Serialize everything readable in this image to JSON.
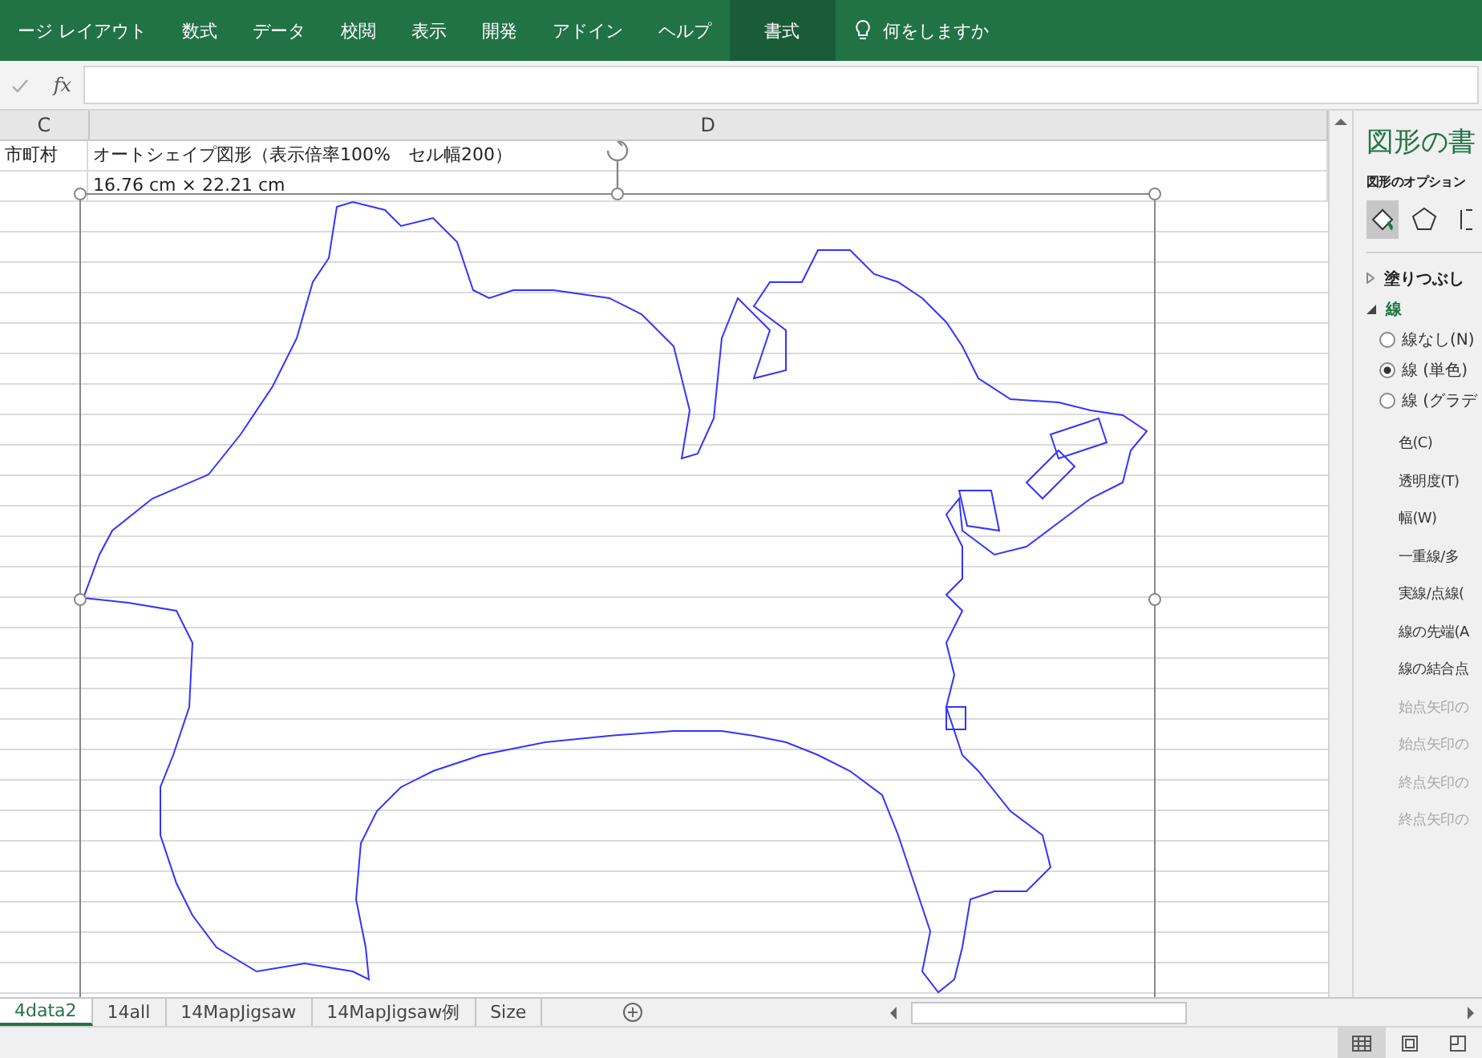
{
  "ribbon": {
    "tabs": [
      {
        "label": "ージ レイアウト",
        "selected": false
      },
      {
        "label": "数式",
        "selected": false
      },
      {
        "label": "データ",
        "selected": false
      },
      {
        "label": "校閲",
        "selected": false
      },
      {
        "label": "表示",
        "selected": false
      },
      {
        "label": "開発",
        "selected": false
      },
      {
        "label": "アドイン",
        "selected": false
      },
      {
        "label": "ヘルプ",
        "selected": false
      },
      {
        "label": "書式",
        "selected": true
      }
    ],
    "tell_me": "何をしますか"
  },
  "formula_bar": {
    "function_label": "fx"
  },
  "columns": [
    "C",
    "D"
  ],
  "rows": [
    {
      "c": "市町村",
      "d": "オートシェイプ図形（表示倍率100%　セル幅200）"
    },
    {
      "c": "",
      "d": "16.76 cm × 22.21 cm"
    }
  ],
  "pane": {
    "title": "図形の書",
    "subtitle": "図形のオプション",
    "sections": [
      {
        "label": "塗りつぶし",
        "expanded": false
      },
      {
        "label": "線",
        "expanded": true
      }
    ],
    "radios": [
      {
        "label": "線なし(N)",
        "selected": false
      },
      {
        "label": "線 (単色)",
        "selected": true
      },
      {
        "label": "線 (グラデ",
        "selected": false
      }
    ],
    "properties": [
      {
        "label": "色(C)",
        "disabled": false
      },
      {
        "label": "透明度(T)",
        "disabled": false
      },
      {
        "label": "幅(W)",
        "disabled": false
      },
      {
        "label": "一重線/多",
        "disabled": false
      },
      {
        "label": "実線/点線(",
        "disabled": false
      },
      {
        "label": "線の先端(A",
        "disabled": false
      },
      {
        "label": "線の結合点",
        "disabled": false
      },
      {
        "label": "始点矢印の",
        "disabled": true
      },
      {
        "label": "始点矢印の",
        "disabled": true
      },
      {
        "label": "終点矢印の",
        "disabled": true
      },
      {
        "label": "終点矢印の",
        "disabled": true
      }
    ]
  },
  "sheet_tabs": [
    {
      "label": "4data2",
      "selected": true
    },
    {
      "label": "14all",
      "selected": false
    },
    {
      "label": "14MapJigsaw",
      "selected": false
    },
    {
      "label": "14MapJigsaw例",
      "selected": false
    },
    {
      "label": "Size",
      "selected": false
    }
  ]
}
